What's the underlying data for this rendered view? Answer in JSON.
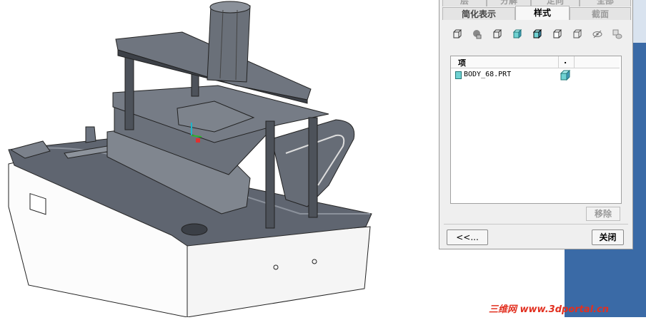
{
  "tabs_top": [
    "层",
    "分解",
    "定向",
    "全部"
  ],
  "tabs": [
    {
      "label": "简化表示",
      "active": false
    },
    {
      "label": "样式",
      "active": true
    },
    {
      "label": "截面",
      "active": false
    }
  ],
  "toolbar_icons": [
    "wireframe-cube-icon",
    "shaded-sphere-icon",
    "hidden-line-cube-icon",
    "shaded-cube-icon",
    "shaded-edges-cube-icon",
    "no-hidden-cube-icon",
    "transparent-cube-icon",
    "hide-eye-icon",
    "layer-stack-icon"
  ],
  "list": {
    "columns": [
      "项",
      "."
    ],
    "rows": [
      {
        "name": "BODY_68.PRT",
        "icon": "shaded-cube-icon"
      }
    ]
  },
  "buttons": {
    "remove": "移除",
    "back": "<<...",
    "close": "关闭"
  },
  "watermark": "三维网 www.3dportal.cn",
  "colors": {
    "accent": "#3a6aa6",
    "model": "#6d7480",
    "cube": "#6fd2d2",
    "watermark": "#e23020"
  }
}
